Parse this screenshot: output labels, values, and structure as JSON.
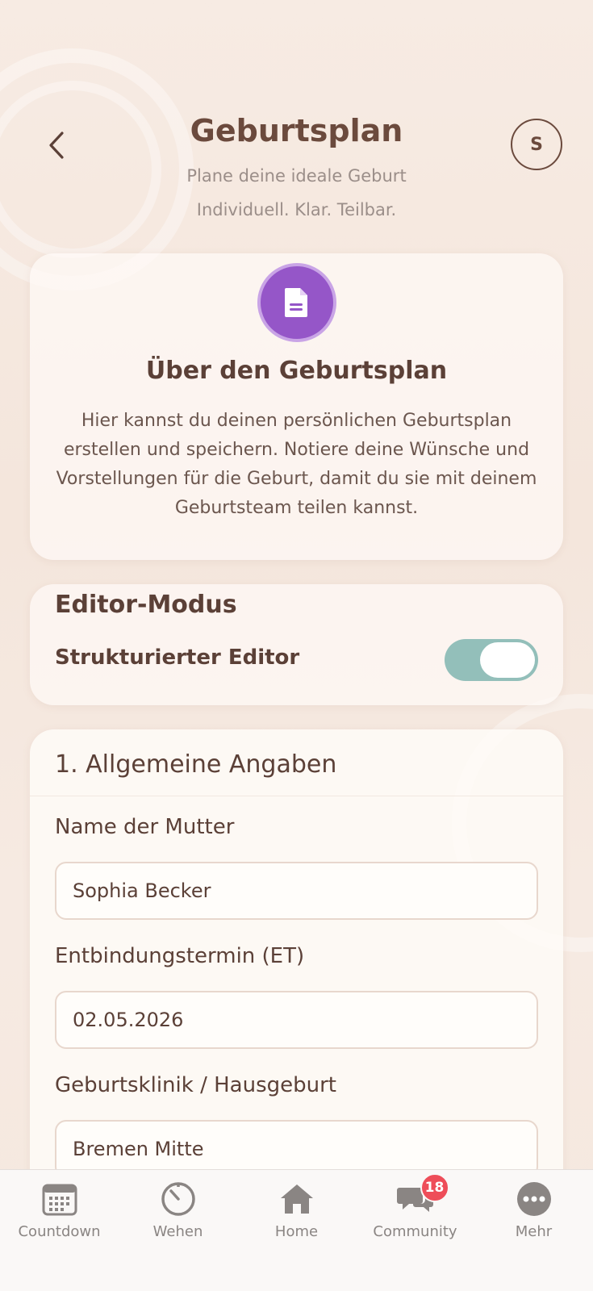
{
  "header": {
    "title": "Geburtsplan",
    "subtitle": "Plane deine ideale Geburt",
    "tagline": "Individuell. Klar. Teilbar.",
    "avatar_initial": "S"
  },
  "about": {
    "title": "Über den Geburtsplan",
    "text": "Hier kannst du deinen persönlichen Geburtsplan erstellen und speichern. Notiere deine Wünsche und Vorstellungen für die Geburt, damit du sie mit deinem Geburtsteam teilen kannst.",
    "badge_color": "#9556c8"
  },
  "editor": {
    "title": "Editor-Modus",
    "label": "Strukturierter Editor",
    "toggle_on": true,
    "toggle_color": "#93bfba"
  },
  "form": {
    "section_title": "1. Allgemeine Angaben",
    "fields": [
      {
        "label": "Name der Mutter",
        "value": "Sophia Becker"
      },
      {
        "label": "Entbindungstermin (ET)",
        "value": "02.05.2026"
      },
      {
        "label": "Geburtsklinik / Hausgeburt",
        "value": "Bremen Mitte"
      }
    ]
  },
  "tabbar": {
    "items": [
      {
        "label": "Countdown",
        "icon": "calendar-icon"
      },
      {
        "label": "Wehen",
        "icon": "timer-icon"
      },
      {
        "label": "Home",
        "icon": "home-icon"
      },
      {
        "label": "Community",
        "icon": "chat-bubbles-icon",
        "badge": "18"
      },
      {
        "label": "Mehr",
        "icon": "more-icon"
      }
    ],
    "badge_color": "#ee4d59"
  }
}
